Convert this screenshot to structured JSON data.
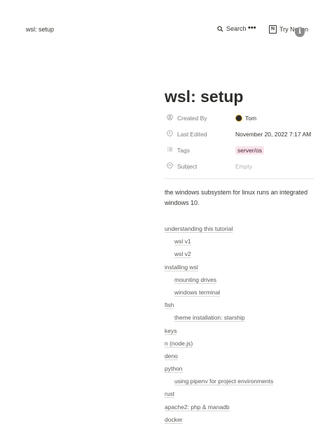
{
  "topbar": {
    "breadcrumb": "wsl: setup",
    "search_label": "Search",
    "more_label": "•••",
    "try_label": "Try Notion"
  },
  "page": {
    "title": "wsl: setup",
    "properties": [
      {
        "name": "Created By",
        "value": "Tom",
        "icon": "person-circle-icon"
      },
      {
        "name": "Last Edited",
        "value": "November 20, 2022 7:17 AM",
        "icon": "clock-icon"
      },
      {
        "name": "Tags",
        "value": "server/os",
        "icon": "list-icon"
      },
      {
        "name": "Subject",
        "value": "Empty",
        "icon": "arrow-circle-icon"
      }
    ],
    "description": "the windows subsystem for linux runs an integrated windows 10.",
    "tag_color": "#f9e4ec"
  },
  "toc": [
    {
      "label": "understanding this tutorial",
      "level": 1
    },
    {
      "label": "wsl v1",
      "level": 2
    },
    {
      "label": "wsl v2",
      "level": 2
    },
    {
      "label": "installing wsl",
      "level": 1
    },
    {
      "label": "mounting drives",
      "level": 2
    },
    {
      "label": "windows terminal",
      "level": 2
    },
    {
      "label": "fish",
      "level": 1
    },
    {
      "label": "theme installation: starship",
      "level": 2
    },
    {
      "label": "keys",
      "level": 1
    },
    {
      "label": "n (node.js)",
      "level": 1
    },
    {
      "label": "deno",
      "level": 1
    },
    {
      "label": "python",
      "level": 1
    },
    {
      "label": "using pipenv for project environments",
      "level": 2
    },
    {
      "label": "rust",
      "level": 1
    },
    {
      "label": "apache2: php & manadb",
      "level": 1
    },
    {
      "label": "docker",
      "level": 1
    }
  ]
}
